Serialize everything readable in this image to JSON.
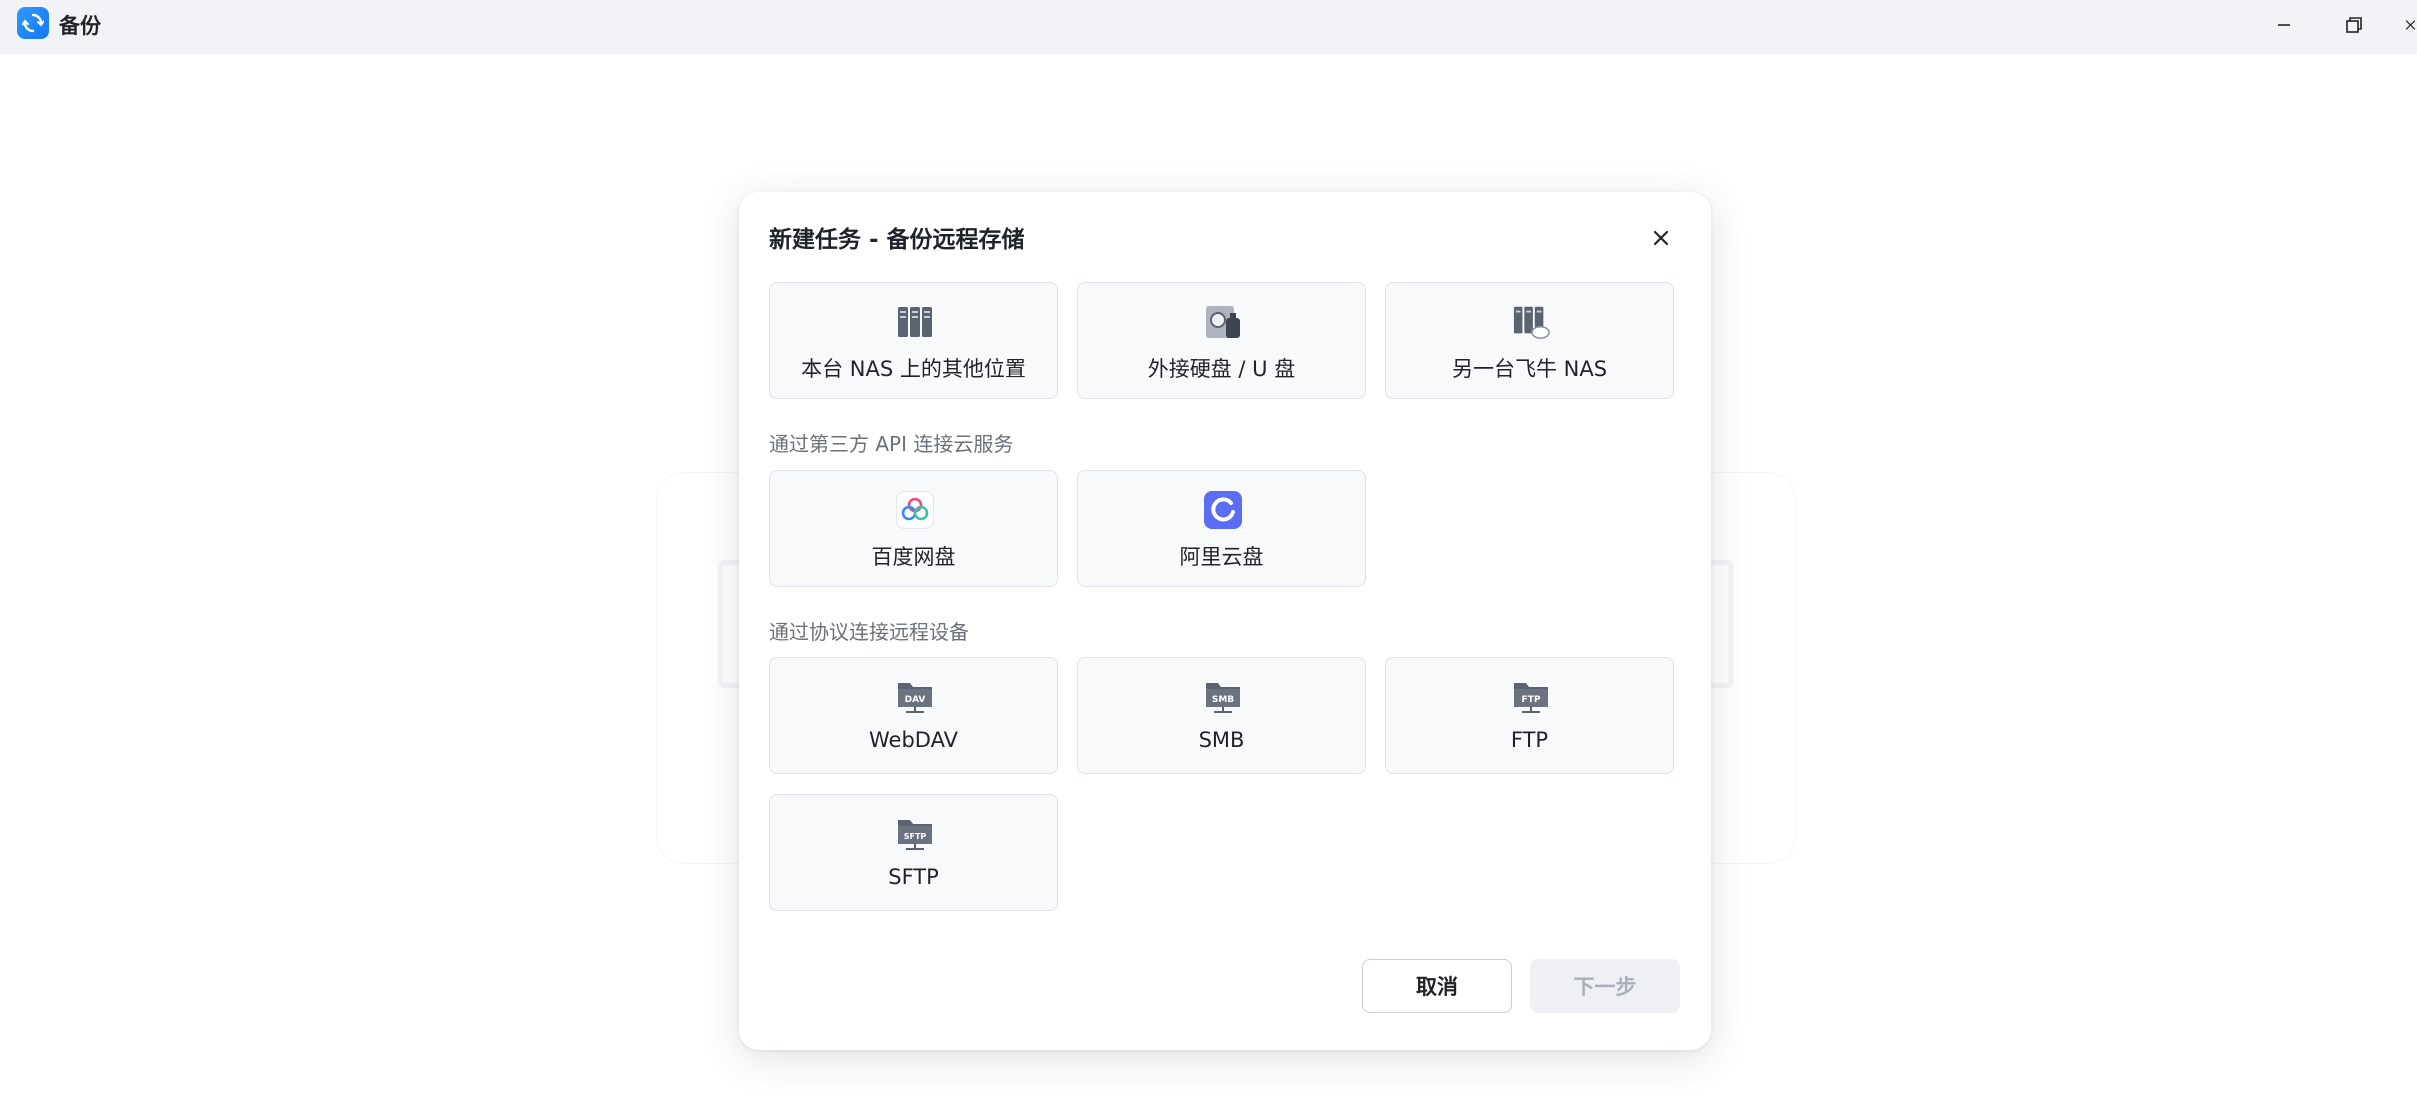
{
  "window": {
    "title": "备份",
    "app_icon": "backup-sync-icon",
    "controls": [
      "minimize-icon",
      "maximize-icon",
      "close-icon"
    ]
  },
  "dialog": {
    "title": "新建任务 - 备份远程存储",
    "close_icon": "close-icon",
    "local_options": [
      {
        "label": "本台 NAS 上的其他位置",
        "icon": "nas-server-icon"
      },
      {
        "label": "外接硬盘 / U 盘",
        "icon": "external-drive-icon"
      },
      {
        "label": "另一台飞牛 NAS",
        "icon": "remote-nas-icon"
      }
    ],
    "cloud_section_label": "通过第三方 API 连接云服务",
    "cloud_options": [
      {
        "label": "百度网盘",
        "icon": "baidu-netdisk-icon"
      },
      {
        "label": "阿里云盘",
        "icon": "aliyun-drive-icon"
      }
    ],
    "protocol_section_label": "通过协议连接远程设备",
    "protocol_options": [
      {
        "label": "WebDAV",
        "icon": "webdav-folder-icon",
        "badge": "DAV"
      },
      {
        "label": "SMB",
        "icon": "smb-folder-icon",
        "badge": "SMB"
      },
      {
        "label": "FTP",
        "icon": "ftp-folder-icon",
        "badge": "FTP"
      },
      {
        "label": "SFTP",
        "icon": "sftp-folder-icon",
        "badge": "SFTP"
      }
    ],
    "cancel_label": "取消",
    "next_label": "下一步"
  },
  "colors": {
    "accent": "#1677f2",
    "titlebar_bg": "#f2f3f7",
    "card_bg": "#f8f9fb",
    "card_border": "#dfe2e8",
    "disabled_text": "#a9aeb8"
  }
}
